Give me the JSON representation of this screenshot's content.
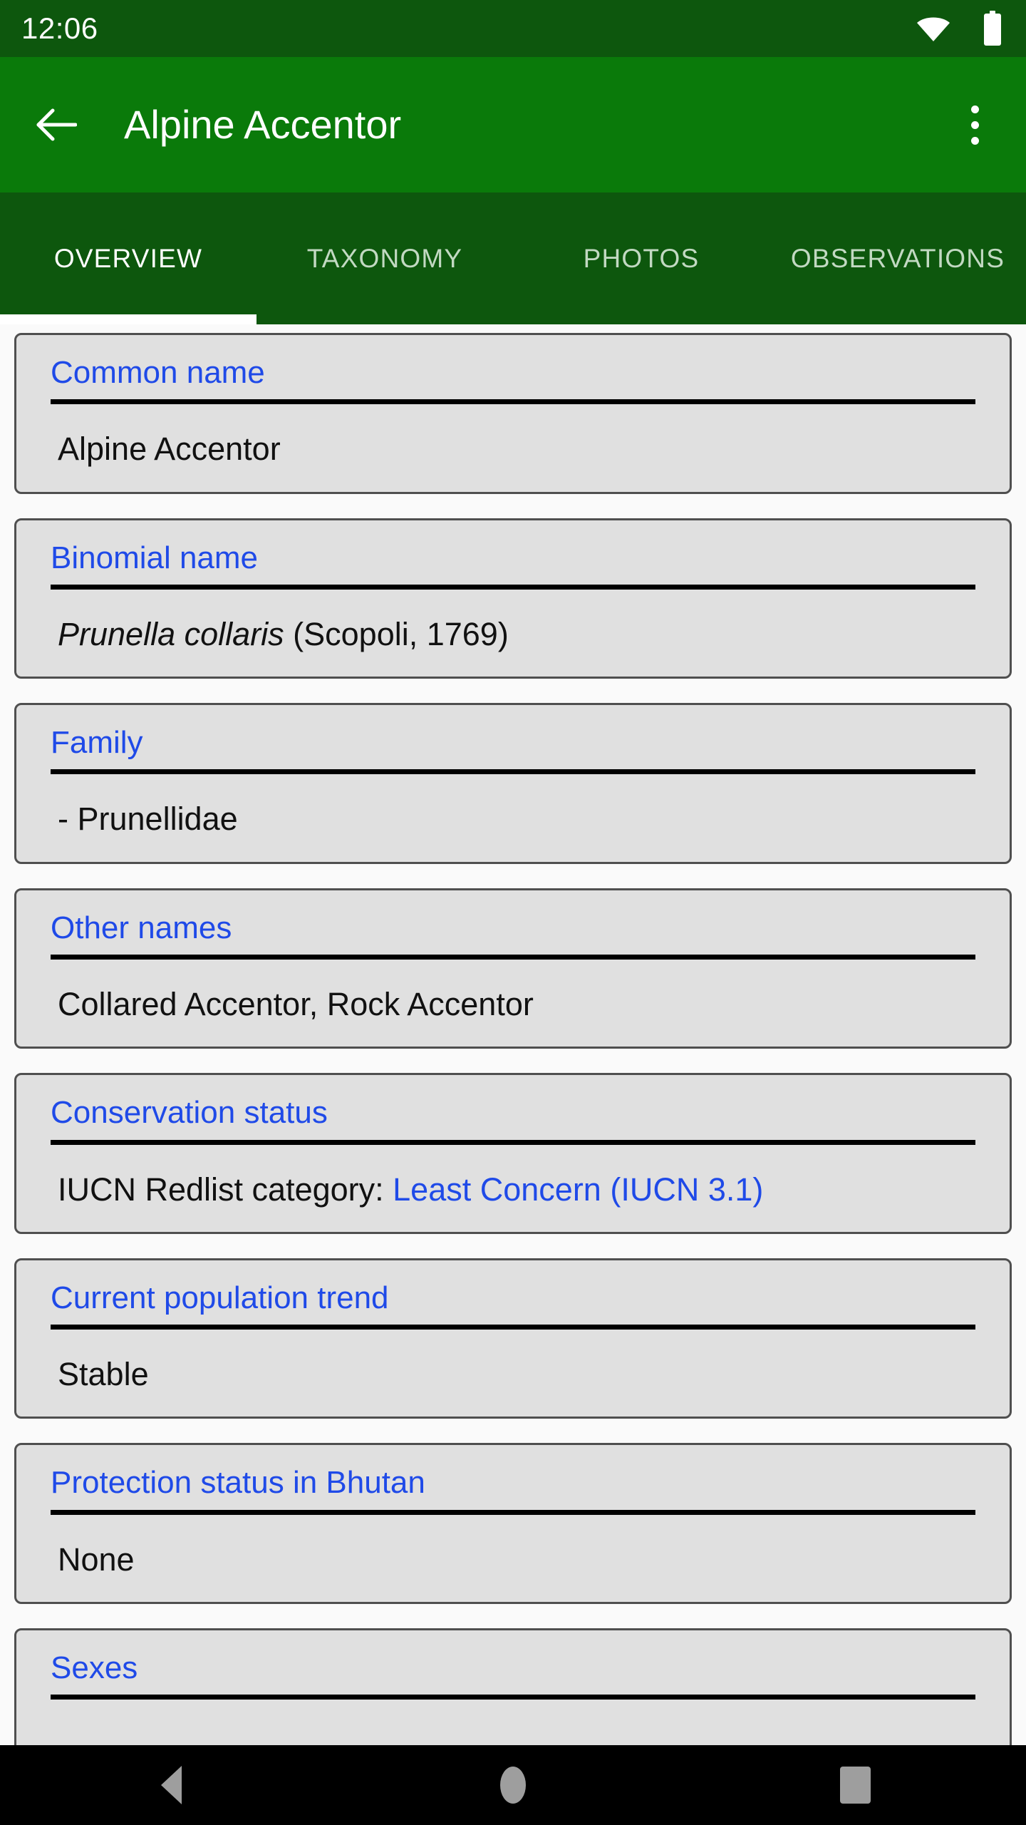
{
  "status_bar": {
    "time": "12:06",
    "wifi_icon": "wifi-icon",
    "battery_icon": "battery-icon"
  },
  "app_bar": {
    "back_icon": "back-arrow-icon",
    "title": "Alpine Accentor",
    "overflow_icon": "more-vertical-icon"
  },
  "tabs": [
    {
      "label": "OVERVIEW",
      "active": true
    },
    {
      "label": "TAXONOMY",
      "active": false
    },
    {
      "label": "PHOTOS",
      "active": false
    },
    {
      "label": "OBSERVATIONS",
      "active": false
    }
  ],
  "cards": [
    {
      "title": "Common name",
      "value": "Alpine Accentor"
    },
    {
      "title": "Binomial name",
      "value_sci": "Prunella collaris",
      "value_rest": " (Scopoli, 1769)"
    },
    {
      "title": "Family",
      "value": "- Prunellidae"
    },
    {
      "title": "Other names",
      "value": "Collared Accentor, Rock Accentor"
    },
    {
      "title": "Conservation status",
      "value_label": "IUCN Redlist category: ",
      "value_link": "Least Concern (IUCN 3.1)"
    },
    {
      "title": "Current population trend",
      "value": "Stable"
    },
    {
      "title": "Protection status in Bhutan",
      "value": "None"
    },
    {
      "title": "Sexes",
      "value": ""
    }
  ],
  "nav_bar": {
    "back_icon": "nav-back-triangle-icon",
    "home_icon": "nav-home-circle-icon",
    "recents_icon": "nav-recents-square-icon"
  },
  "colors": {
    "status_bar_green": "#0d570d",
    "app_bar_green": "#0a7a0a",
    "tab_bar_green": "#0d570d",
    "accent_blue": "#1f4ae8",
    "card_fill": "#e0e0e0",
    "card_border": "#4f4f4f",
    "page_background": "#fafafa",
    "nav_bar_black": "#000000",
    "nav_icon_gray": "#9e9e9e"
  }
}
